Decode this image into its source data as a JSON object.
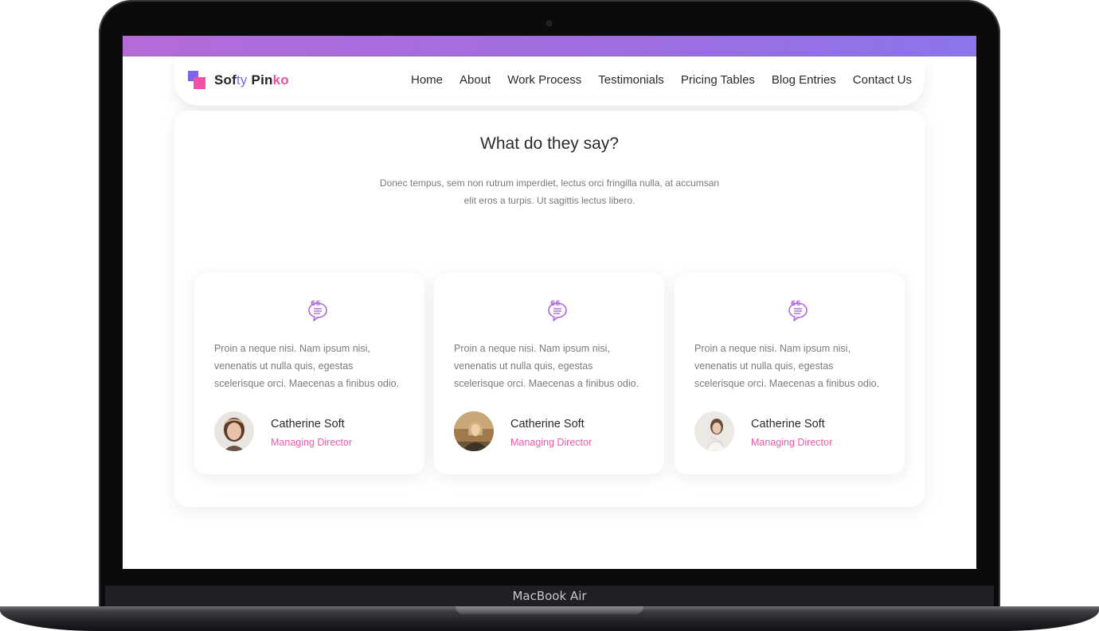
{
  "device": {
    "label": "MacBook Air"
  },
  "brand": {
    "part1": "Sof",
    "part2": "ty",
    "part3": " Pin",
    "part4": "ko"
  },
  "nav": [
    "Home",
    "About",
    "Work Process",
    "Testimonials",
    "Pricing Tables",
    "Blog Entries",
    "Contact Us"
  ],
  "section": {
    "title": "What do they say?",
    "subtitle": "Donec tempus, sem non rutrum imperdiet, lectus orci fringilla nulla, at accumsan elit eros a turpis. Ut sagittis lectus libero."
  },
  "testimonials": [
    {
      "text": "Proin a neque nisi. Nam ipsum nisi, venenatis ut nulla quis, egestas scelerisque orci. Maecenas a finibus odio.",
      "name": "Catherine Soft",
      "role": "Managing Director"
    },
    {
      "text": "Proin a neque nisi. Nam ipsum nisi, venenatis ut nulla quis, egestas scelerisque orci. Maecenas a finibus odio.",
      "name": "Catherine Soft",
      "role": "Managing Director"
    },
    {
      "text": "Proin a neque nisi. Nam ipsum nisi, venenatis ut nulla quis, egestas scelerisque orci. Maecenas a finibus odio.",
      "name": "Catherine Soft",
      "role": "Managing Director"
    }
  ],
  "colors": {
    "accent_pink": "#f05aa8",
    "accent_purple": "#7a67e8",
    "gradient_start": "#b46bd8",
    "gradient_end": "#8b74ec"
  }
}
